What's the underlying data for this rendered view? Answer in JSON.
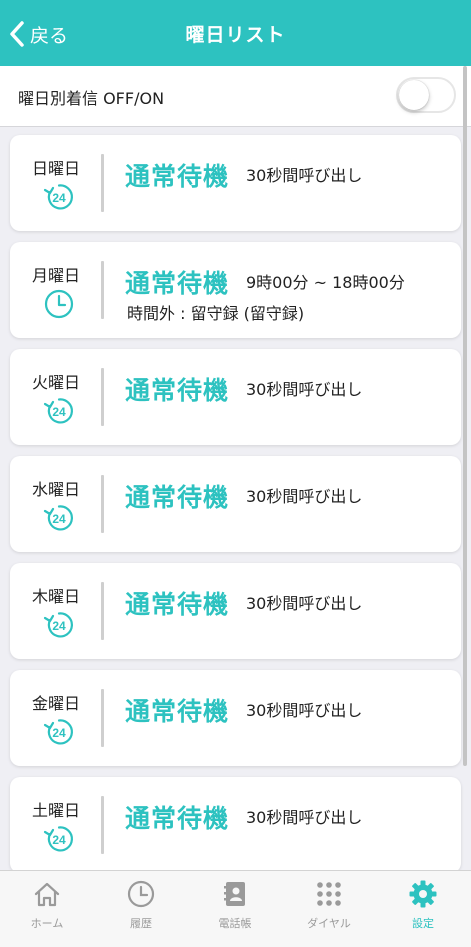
{
  "header": {
    "back_label": "戻る",
    "title": "曜日リスト",
    "bg_color": "#2dc2c0"
  },
  "toggle": {
    "label": "曜日別着信 OFF/ON",
    "state": "off"
  },
  "days": [
    {
      "day": "日曜日",
      "icon": "clock-24-icon",
      "mode": "通常待機",
      "detail": "30秒間呼び出し",
      "sub": ""
    },
    {
      "day": "月曜日",
      "icon": "clock-icon",
      "mode": "通常待機",
      "detail": "9時00分 ~ 18時00分",
      "sub": "時間外 : 留守録 (留守録)"
    },
    {
      "day": "火曜日",
      "icon": "clock-24-icon",
      "mode": "通常待機",
      "detail": "30秒間呼び出し",
      "sub": ""
    },
    {
      "day": "水曜日",
      "icon": "clock-24-icon",
      "mode": "通常待機",
      "detail": "30秒間呼び出し",
      "sub": ""
    },
    {
      "day": "木曜日",
      "icon": "clock-24-icon",
      "mode": "通常待機",
      "detail": "30秒間呼び出し",
      "sub": ""
    },
    {
      "day": "金曜日",
      "icon": "clock-24-icon",
      "mode": "通常待機",
      "detail": "30秒間呼び出し",
      "sub": ""
    },
    {
      "day": "土曜日",
      "icon": "clock-24-icon",
      "mode": "通常待機",
      "detail": "30秒間呼び出し",
      "sub": ""
    }
  ],
  "icon_24_text": "24",
  "tabs": [
    {
      "label": "ホーム",
      "icon": "home-icon",
      "active": false
    },
    {
      "label": "履歴",
      "icon": "history-clock-icon",
      "active": false
    },
    {
      "label": "電話帳",
      "icon": "phonebook-icon",
      "active": false
    },
    {
      "label": "ダイヤル",
      "icon": "dialpad-icon",
      "active": false
    },
    {
      "label": "設定",
      "icon": "gear-icon",
      "active": true
    }
  ],
  "colors": {
    "accent": "#2dc2c0",
    "inactive": "#9a9a9a"
  }
}
